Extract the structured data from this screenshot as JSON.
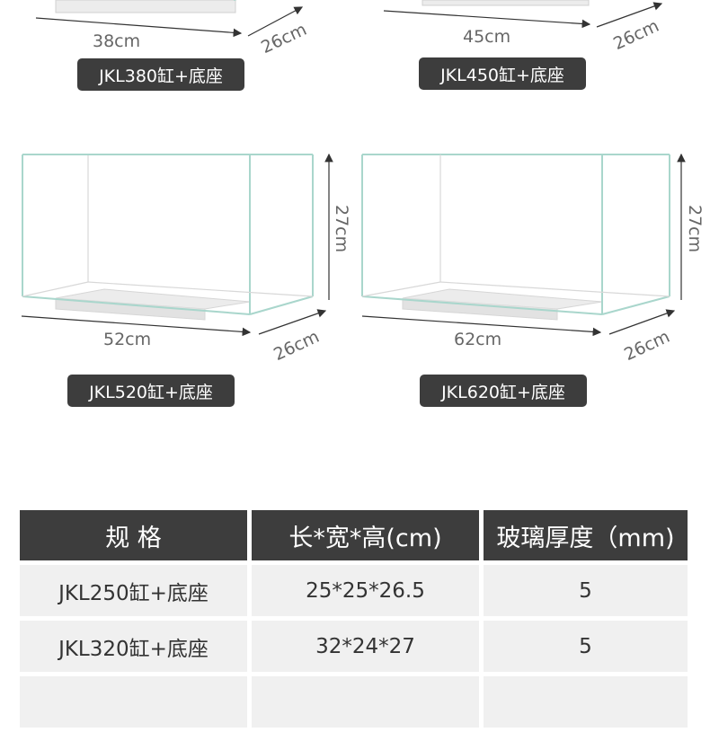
{
  "tanks": [
    {
      "name": "JKL380缸+底座",
      "length": "38cm",
      "width": "26cm"
    },
    {
      "name": "JKL450缸+底座",
      "length": "45cm",
      "width": "26cm"
    },
    {
      "name": "JKL520缸+底座",
      "length": "52cm",
      "width": "26cm",
      "height": "27cm"
    },
    {
      "name": "JKL620缸+底座",
      "length": "62cm",
      "width": "26cm",
      "height": "27cm"
    }
  ],
  "spec_table": {
    "headers": [
      "规 格",
      "长*宽*高(cm)",
      "玻璃厚度（mm)"
    ],
    "rows": [
      [
        "JKL250缸+底座",
        "25*25*26.5",
        "5"
      ],
      [
        "JKL320缸+底座",
        "32*24*27",
        "5"
      ],
      [
        "",
        "",
        ""
      ]
    ]
  },
  "colors": {
    "pill_bg": "#3d3d3d",
    "header_bg": "#3d3d3d",
    "row_bg": "#f0f0f0",
    "glass_edge": "#a9d6cc"
  }
}
